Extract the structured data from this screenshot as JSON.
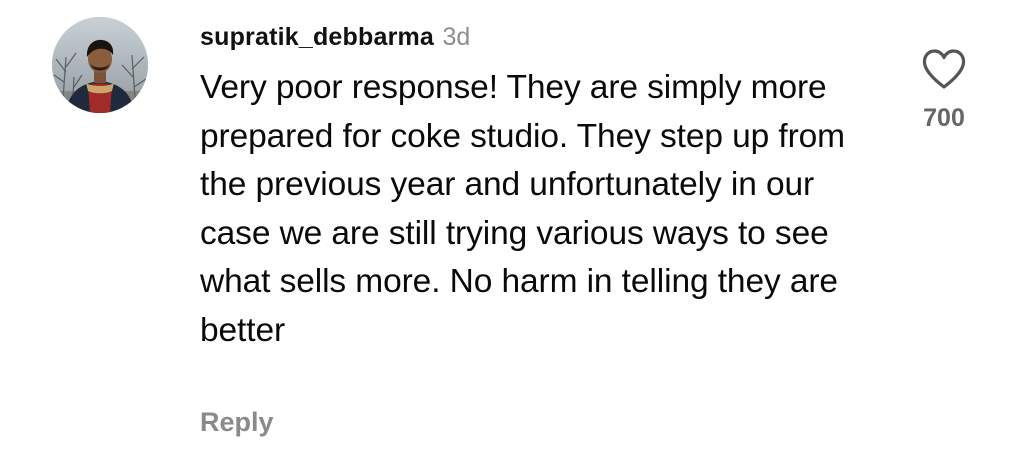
{
  "comment": {
    "username": "supratik_debbarma",
    "time": "3d",
    "text": "Very poor response! They are simply more prepared for coke studio. They step up from the previous year and unfortunately in our case we are still trying various ways to see what sells more. No harm in telling they are better",
    "reply_label": "Reply",
    "like_count": "700",
    "avatar_icon": "user-avatar",
    "like_icon": "heart-outline-icon"
  }
}
